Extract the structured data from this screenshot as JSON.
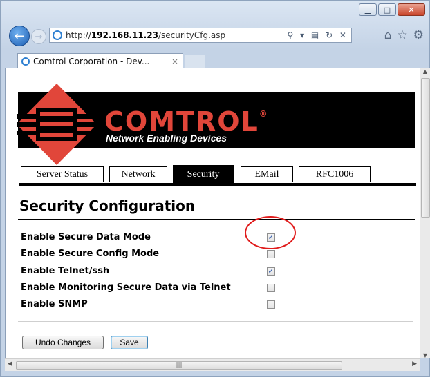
{
  "browser": {
    "url_prefix": "http://",
    "url_host": "192.168.11.23",
    "url_path": "/securityCfg.asp",
    "tab_title": "Comtrol Corporation - Dev...",
    "tab_close": "×",
    "address_tools": "⚲ ▾ ▤ ↻ ✕",
    "window_minimize": "▁",
    "window_maximize": "□",
    "window_close": "✕"
  },
  "page": {
    "brand": "COMTROL",
    "brand_reg": "®",
    "tagline": "Network Enabling Devices",
    "nav_tabs": [
      {
        "label": "Server Status"
      },
      {
        "label": "Network"
      },
      {
        "label": "Security",
        "active": true
      },
      {
        "label": "EMail"
      },
      {
        "label": "RFC1006"
      }
    ],
    "heading": "Security Configuration",
    "settings": [
      {
        "label": "Enable Secure Data Mode",
        "checked": true
      },
      {
        "label": "Enable Secure Config Mode",
        "checked": false
      },
      {
        "label": "Enable Telnet/ssh",
        "checked": true
      },
      {
        "label": "Enable Monitoring Secure Data via Telnet",
        "checked": false
      },
      {
        "label": "Enable SNMP",
        "checked": false
      }
    ],
    "buttons": {
      "undo": "Undo Changes",
      "save": "Save"
    }
  },
  "colors": {
    "brand_red": "#e1463a",
    "annotation_red": "#e01b1b",
    "checkmark": "#2b56a8"
  }
}
